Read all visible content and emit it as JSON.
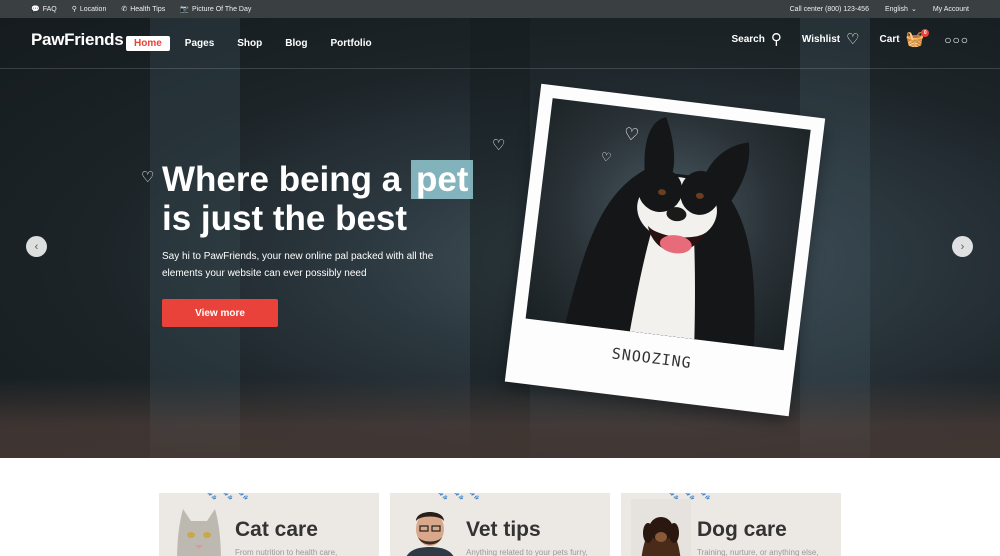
{
  "topbar": {
    "left": [
      {
        "icon": "chat-icon",
        "glyph": "💬",
        "label": "FAQ"
      },
      {
        "icon": "location-pin-icon",
        "glyph": "⚲",
        "label": "Location"
      },
      {
        "icon": "phone-icon",
        "glyph": "✆",
        "label": "Health Tips"
      },
      {
        "icon": "camera-icon",
        "glyph": "📷",
        "label": "Picture Of The Day"
      }
    ],
    "call_center": "Call center (800) 123-456",
    "language": "English",
    "language_caret": "⌄",
    "account": "My Account"
  },
  "header": {
    "logo": "PawFriends",
    "nav": [
      {
        "label": "Home",
        "active": true
      },
      {
        "label": "Pages",
        "active": false
      },
      {
        "label": "Shop",
        "active": false
      },
      {
        "label": "Blog",
        "active": false
      },
      {
        "label": "Portfolio",
        "active": false
      }
    ],
    "search_label": "Search",
    "search_glyph": "⚲",
    "wishlist_label": "Wishlist",
    "wishlist_glyph": "♡",
    "cart_label": "Cart",
    "cart_glyph": "🧺",
    "cart_count": "0",
    "more_glyph": "○○○"
  },
  "hero": {
    "headline_line1_pre": "Where being a ",
    "headline_highlight": "pet",
    "headline_line2": "is just the best",
    "subtext": "Say hi to PawFriends, your new online pal packed with all the elements your website can ever possibly need",
    "cta_label": "View more",
    "prev_glyph": "‹",
    "next_glyph": "›",
    "polaroid_caption": "SNOOZING",
    "heart_glyph": "♡"
  },
  "services": [
    {
      "title": "Cat care",
      "desc": "From nutrition to health care,",
      "image": "cat-photo"
    },
    {
      "title": "Vet tips",
      "desc": "Anything related to your pets furry,",
      "image": "vet-photo"
    },
    {
      "title": "Dog care",
      "desc": "Training, nurture, or anything else,",
      "image": "dog-photo"
    }
  ],
  "colors": {
    "accent": "#e8423a",
    "topbar_bg": "#3a3f42",
    "card_bg": "#ece8e4",
    "highlight": "#a0dce6"
  }
}
